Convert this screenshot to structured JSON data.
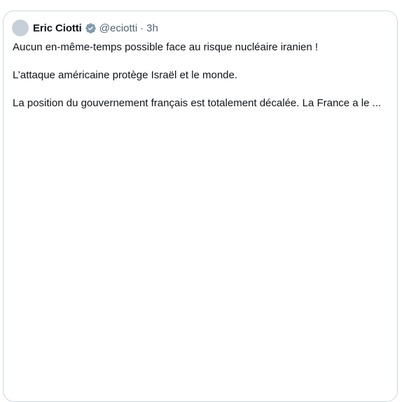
{
  "tweet": {
    "author": {
      "display_name": "Eric Ciotti",
      "handle": "@eciotti",
      "verified": true,
      "avatar_color": "#c7d0d8"
    },
    "separator": "·",
    "time": "3h",
    "lines": [
      "Aucun en-même-temps possible face au risque nucléaire iranien !",
      "L’attaque américaine protège Israël et le monde.",
      "La position du gouvernement français est totalement décalée. La France a le ..."
    ]
  },
  "colors": {
    "text": "#0f1419",
    "secondary_text": "#536471",
    "border": "#cfd9de",
    "verified_badge": "#829aab"
  },
  "icons": {
    "verified": "verified-badge-icon"
  }
}
